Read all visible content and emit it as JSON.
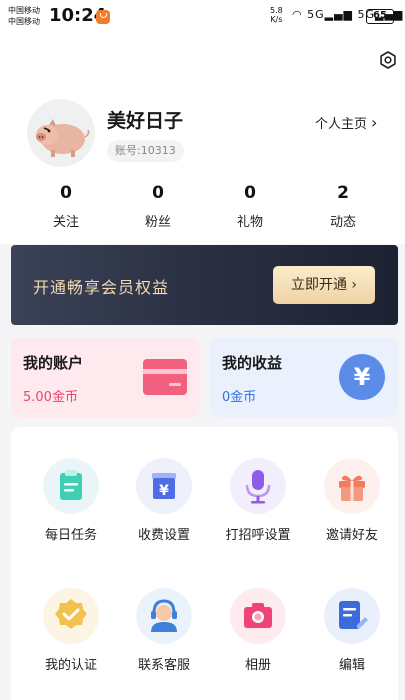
{
  "status_bar": {
    "carrier_1": "中国移动",
    "carrier_2": "中国移动",
    "time": "10:24",
    "net_speed_value": "5.8",
    "net_speed_unit": "K/s",
    "icons": "◠ 5G▂▄▆ 5G▂▄▆",
    "battery": "65"
  },
  "profile": {
    "nickname": "美好日子",
    "account_id": "账号:10313",
    "homepage_link": "个人主页",
    "avatar_icon": "pig-avatar-icon"
  },
  "stats": [
    {
      "value": "0",
      "label": "关注"
    },
    {
      "value": "0",
      "label": "粉丝"
    },
    {
      "value": "0",
      "label": "礼物"
    },
    {
      "value": "2",
      "label": "动态"
    }
  ],
  "vip": {
    "text": "开通畅享会员权益",
    "button": "立即开通",
    "button_arrow": "›"
  },
  "cards": {
    "account": {
      "title": "我的账户",
      "value": "5.00金币",
      "icon": "card-icon"
    },
    "income": {
      "title": "我的收益",
      "value": "0金币",
      "icon": "yuan-icon"
    }
  },
  "grid": [
    {
      "label": "每日任务",
      "icon": "task-clipboard-icon"
    },
    {
      "label": "收费设置",
      "icon": "yuan-box-icon"
    },
    {
      "label": "打招呼设置",
      "icon": "microphone-icon"
    },
    {
      "label": "邀请好友",
      "icon": "gift-icon"
    },
    {
      "label": "我的认证",
      "icon": "verified-badge-icon"
    },
    {
      "label": "联系客服",
      "icon": "customer-service-icon"
    },
    {
      "label": "相册",
      "icon": "camera-icon"
    },
    {
      "label": "编辑",
      "icon": "edit-document-icon"
    }
  ],
  "colors": {
    "accent_pink": "#f0436b",
    "accent_blue": "#3a6fd8",
    "vip_gold": "#f1d9b0"
  }
}
